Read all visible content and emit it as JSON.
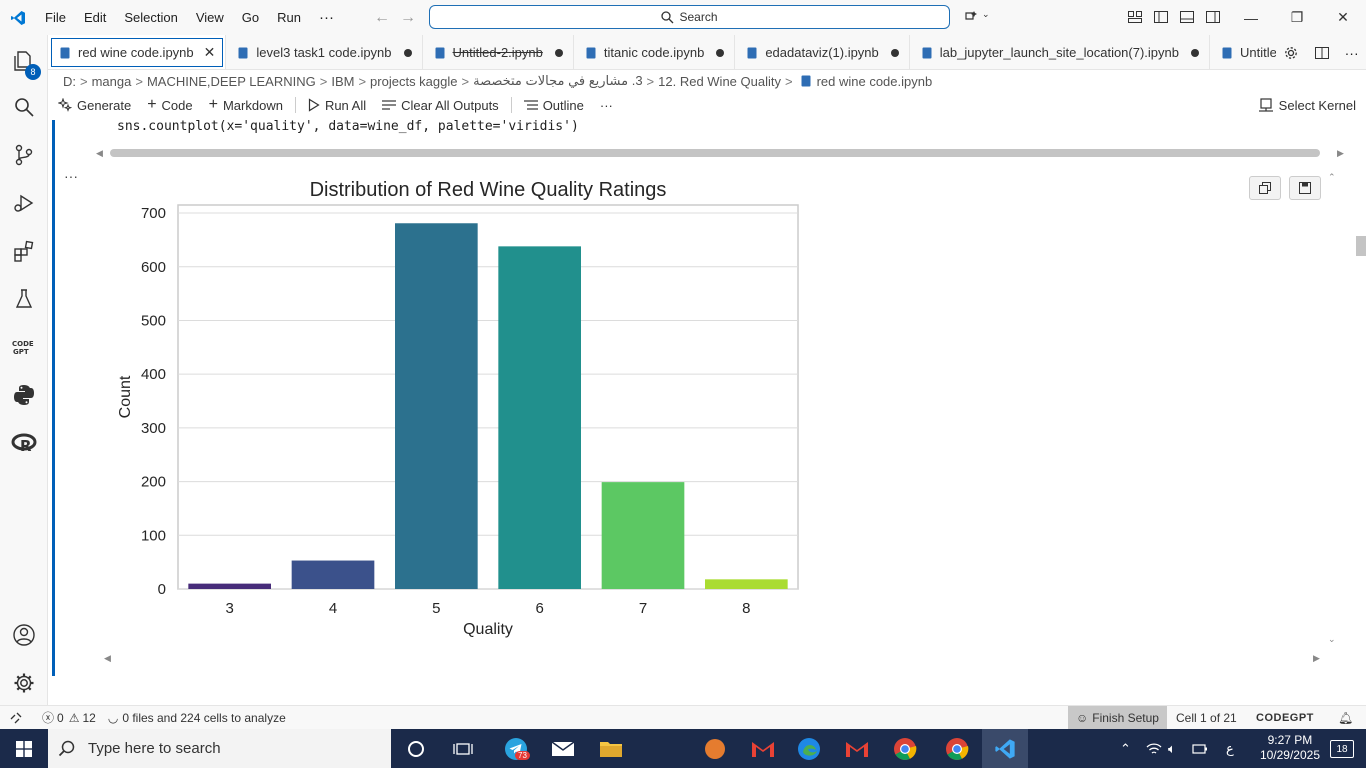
{
  "menu": {
    "items": [
      "File",
      "Edit",
      "Selection",
      "View",
      "Go",
      "Run"
    ],
    "more": "···"
  },
  "search": {
    "label": "Search"
  },
  "activity": {
    "explorer_badge": "8"
  },
  "tabs": [
    {
      "label": "red wine code.ipynb",
      "active": true,
      "close": "✕"
    },
    {
      "label": "level3 task1 code.ipynb",
      "dirty": true
    },
    {
      "label": "Untitled-2.ipynb",
      "dirty": true,
      "strike": true
    },
    {
      "label": "titanic code.ipynb",
      "dirty": true
    },
    {
      "label": "edadataviz(1).ipynb",
      "dirty": true
    },
    {
      "label": "lab_jupyter_launch_site_location(7).ipynb",
      "dirty": true
    },
    {
      "label": "Untitled"
    }
  ],
  "breadcrumb": [
    "D:",
    "manga",
    "MACHINE,DEEP LEARNING",
    "IBM",
    "projects kaggle",
    "3. مشاريع في مجالات متخصصة",
    "12. Red Wine Quality",
    "red wine code.ipynb"
  ],
  "toolbar": {
    "generate": "Generate",
    "code": "Code",
    "markdown": "Markdown",
    "run_all": "Run All",
    "clear_outputs": "Clear All Outputs",
    "outline": "Outline",
    "more": "···",
    "select_kernel": "Select Kernel"
  },
  "cell": {
    "code": "sns.countplot(x='quality', data=wine_df, palette='viridis')",
    "output_more": "···"
  },
  "chart_data": {
    "type": "bar",
    "title": "Distribution of Red Wine Quality Ratings",
    "xlabel": "Quality",
    "ylabel": "Count",
    "categories": [
      "3",
      "4",
      "5",
      "6",
      "7",
      "8"
    ],
    "values": [
      10,
      53,
      681,
      638,
      199,
      18
    ],
    "colors": [
      "#472c7a",
      "#3b518b",
      "#2c718e",
      "#21908d",
      "#5cc863",
      "#aadc32"
    ],
    "ylim": [
      0,
      715
    ],
    "yticks": [
      0,
      100,
      200,
      300,
      400,
      500,
      600,
      700
    ],
    "grid": true,
    "legend": "none"
  },
  "status": {
    "errors": "0",
    "warnings": "12",
    "analyze": "0 files and 224 cells to analyze",
    "finish_setup": "Finish Setup",
    "cell_pos": "Cell 1 of 21",
    "codegpt": "CODEGPT"
  },
  "taskbar": {
    "search_placeholder": "Type here to search",
    "telegram_badge": "73",
    "time": "9:27 PM",
    "date": "10/29/2025",
    "lang": "ع",
    "notif_count": "18"
  },
  "colors": {
    "accent": "#005fb8",
    "taskbar": "#1b2a4a"
  }
}
